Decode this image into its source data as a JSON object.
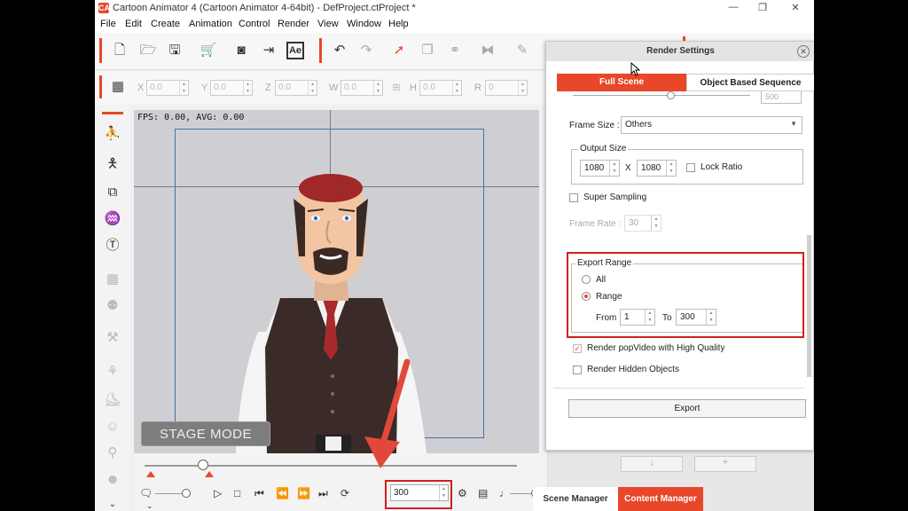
{
  "window": {
    "title": "Cartoon Animator 4  (Cartoon Animator 4-64bit) - DefProject.ctProject *",
    "logo_text": "CA",
    "controls": [
      "—",
      "❐",
      "✕"
    ]
  },
  "menu": [
    "File",
    "Edit",
    "Create",
    "Animation",
    "Control",
    "Render",
    "View",
    "Window",
    "Help"
  ],
  "toolbar": {
    "ae_label": "Ae"
  },
  "transform": {
    "x_label": "X",
    "x_value": "0.0",
    "y_label": "Y",
    "y_value": "0.0",
    "z_label": "Z",
    "z_value": "0.0",
    "w_label": "W",
    "w_value": "0.0",
    "h_label": "H",
    "h_value": "0.0",
    "r_label": "R",
    "r_value": "0"
  },
  "viewport": {
    "fps_text": "FPS: 0.00, AVG: 0.00",
    "stage_mode_label": "STAGE MODE"
  },
  "timeline": {
    "frame_value": "300"
  },
  "render_settings": {
    "title": "Render Settings",
    "tabs": [
      "Full Scene",
      "Object Based Sequence"
    ],
    "cut_value": "500",
    "frame_size_label": "Frame Size :",
    "frame_size_value": "Others",
    "output_size_label": "Output Size",
    "width": "1080",
    "x_sep": "X",
    "height": "1080",
    "lock_ratio_label": "Lock Ratio",
    "super_sampling_label": "Super Sampling",
    "frame_rate_label": "Frame Rate :",
    "frame_rate_value": "30",
    "export_range_label": "Export Range",
    "all_label": "All",
    "range_label": "Range",
    "from_label": "From",
    "from_value": "1",
    "to_label": "To",
    "to_value": "300",
    "popvideo_label": "Render popVideo with High Quality",
    "hidden_label": "Render Hidden Objects",
    "export_button": "Export"
  },
  "bottom_tabs": [
    "Scene Manager",
    "Content Manager"
  ],
  "colors": {
    "accent": "#e8472a",
    "highlight_box": "#d02020",
    "arrow": "#e2483a"
  }
}
